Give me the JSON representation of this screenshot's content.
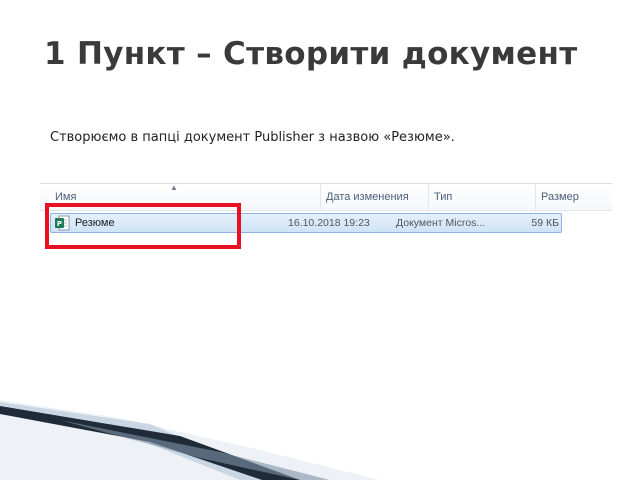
{
  "slide": {
    "title": "1 Пункт – Створити документ",
    "body": "Створюємо в папці документ Publisher з назвою «Резюме»."
  },
  "explorer": {
    "columns": {
      "name": "Имя",
      "date": "Дата изменения",
      "type": "Тип",
      "size": "Размер"
    },
    "sort_indicator": "▲",
    "rows": [
      {
        "name": "Резюме",
        "date": "16.10.2018 19:23",
        "type": "Документ Micros...",
        "size": "59 КБ",
        "icon": "publisher-file-icon",
        "selected": true
      }
    ]
  },
  "colors": {
    "title": "#3a3a3a",
    "highlight": "#e81123",
    "selection": "#cfe3f6",
    "header_text": "#4c607a"
  }
}
